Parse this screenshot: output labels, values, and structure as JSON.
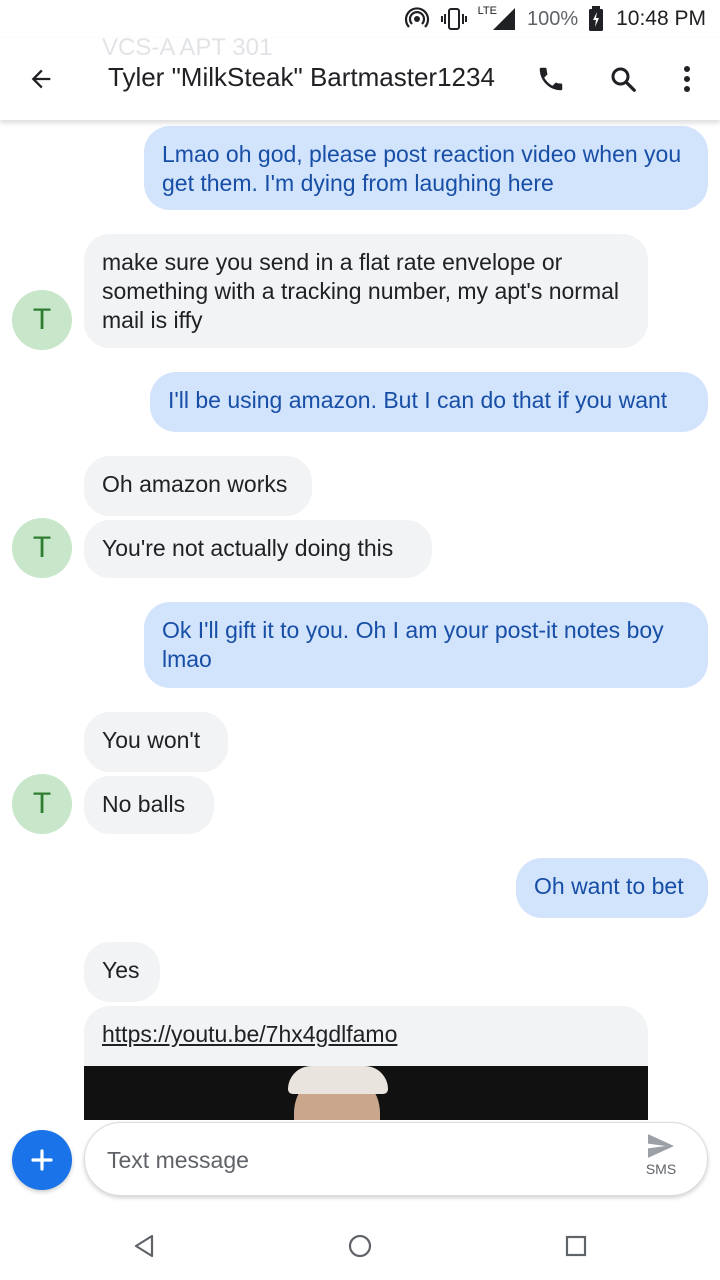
{
  "status_bar": {
    "network_label": "LTE",
    "battery_percent": "100%",
    "time": "10:48 PM"
  },
  "header": {
    "back_icon": "arrow-back-icon",
    "contact_name": "Tyler \"MilkSteak\" Bartmaster1234",
    "ghost_title": "VCS-A APT 301",
    "call_icon": "phone-icon",
    "search_icon": "search-icon",
    "more_icon": "more-vert-icon"
  },
  "contact": {
    "avatar_initial": "T",
    "avatar_color": "#c8e6c9"
  },
  "messages": [
    {
      "direction": "outgoing",
      "text": "Lmao oh god, please post reaction video when you get them. I'm dying from laughing here"
    },
    {
      "direction": "incoming",
      "text": "make sure you send in a flat rate envelope or something with a tracking number, my apt's normal mail is iffy"
    },
    {
      "direction": "outgoing",
      "text": "I'll be using amazon. But I can do that if you want"
    },
    {
      "direction": "incoming",
      "text": "Oh amazon works"
    },
    {
      "direction": "incoming",
      "text": "You're not actually doing this"
    },
    {
      "direction": "outgoing",
      "text": "Ok I'll gift it to you. Oh I am your post-it notes boy lmao"
    },
    {
      "direction": "incoming",
      "text": "You won't"
    },
    {
      "direction": "incoming",
      "text": "No balls"
    },
    {
      "direction": "outgoing",
      "text": "Oh want to bet"
    },
    {
      "direction": "incoming",
      "text": "Yes"
    },
    {
      "direction": "incoming",
      "text": "https://youtu.be/7hx4gdlfamo",
      "type": "link"
    }
  ],
  "compose": {
    "placeholder": "Text message",
    "send_label": "SMS",
    "add_icon": "plus-icon",
    "send_icon": "send-icon"
  },
  "nav": {
    "back_icon": "nav-back-icon",
    "home_icon": "nav-home-icon",
    "recents_icon": "nav-recents-icon"
  },
  "colors": {
    "outgoing_bubble": "#d2e3fc",
    "outgoing_text": "#174ea6",
    "incoming_bubble": "#f1f3f4",
    "fab": "#1a73e8"
  }
}
